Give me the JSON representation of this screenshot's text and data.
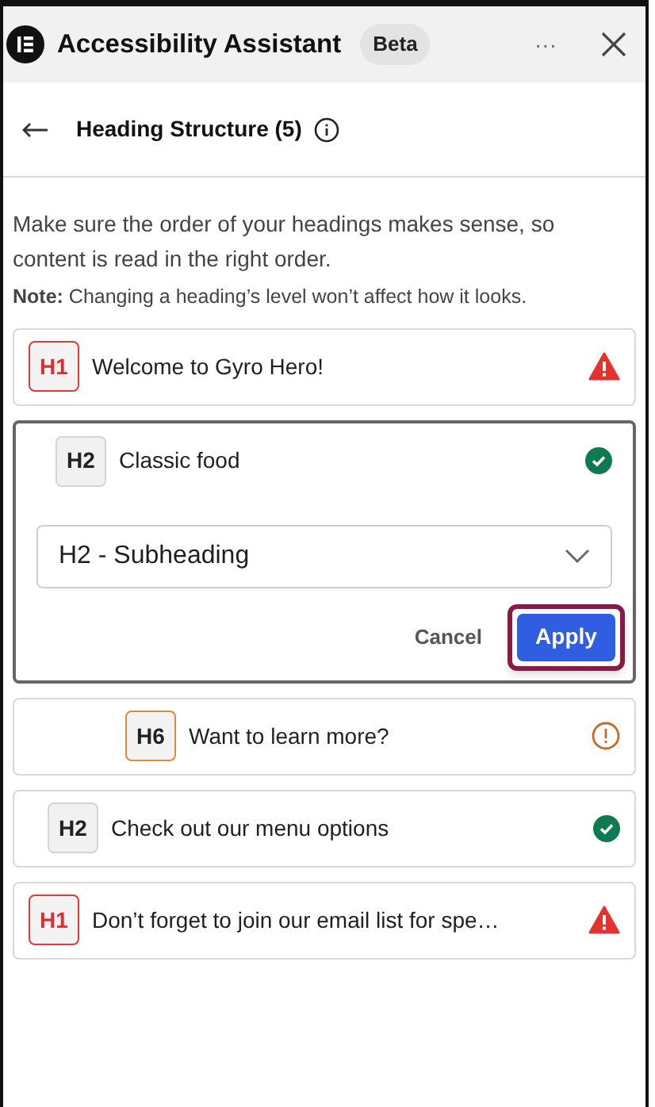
{
  "header": {
    "title": "Accessibility Assistant",
    "badge": "Beta",
    "more": "···"
  },
  "subheader": {
    "title": "Heading Structure (5)"
  },
  "intro": {
    "text": "Make sure the order of your headings makes sense, so content is read in the right order.",
    "note": "**Note:** Changing a heading’s level won’t affect how it looks."
  },
  "headings": [
    {
      "tag": "H1",
      "text": "Welcome to Gyro Hero!",
      "kind": "error",
      "expanded": false,
      "children": [
        {
          "tag": "H2",
          "text": "Classic food",
          "kind": "ok",
          "expanded": true,
          "select": {
            "value": "H2 - Subheading"
          },
          "cancel": "Cancel",
          "apply": {
            "label": "Apply",
            "focused": true
          },
          "children": [
            {
              "tag": "H6",
              "text": "Want to learn more?",
              "kind": "warning",
              "expanded": false
            }
          ]
        },
        {
          "tag": "H2",
          "text": "Check out our menu options",
          "kind": "ok",
          "expanded": false
        }
      ]
    },
    {
      "tag": "H1",
      "text": "Don’t forget to join our email list for spe…",
      "kind": "error",
      "expanded": false
    }
  ]
}
